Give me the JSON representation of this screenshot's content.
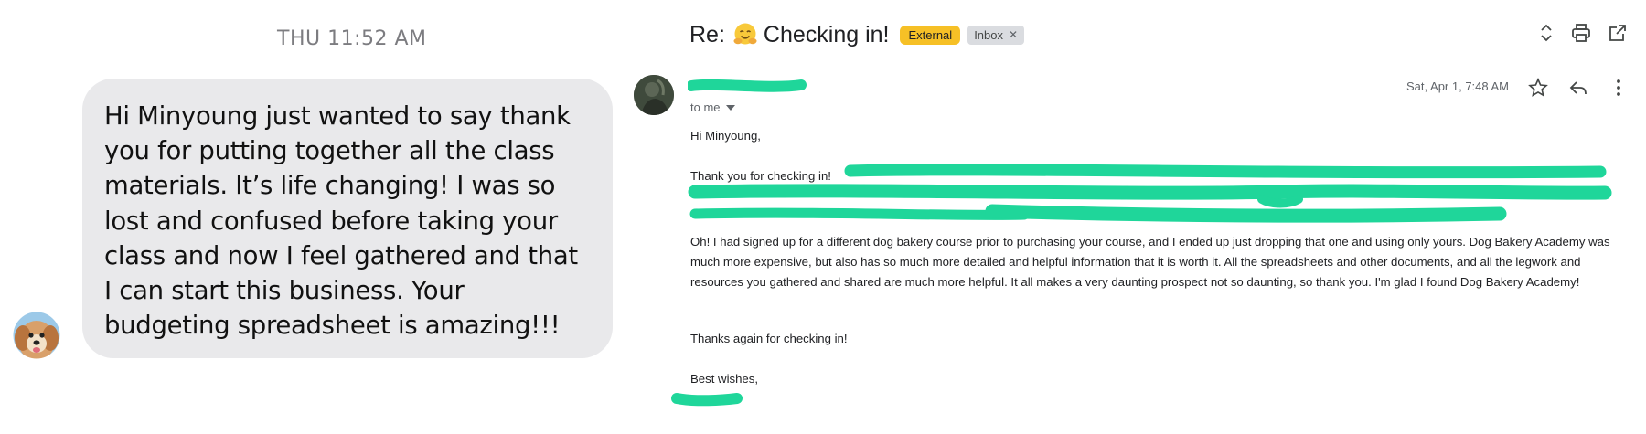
{
  "message": {
    "timestamp": "THU 11:52 AM",
    "bubble_text": "Hi Minyoung just wanted to say thank you for putting together all the class materials. It’s life changing! I was so lost and confused before taking your class and now I feel gathered and that I can start this business. Your budgeting spreadsheet is amazing!!!"
  },
  "email": {
    "subject_prefix": "Re:",
    "subject_text": "Checking in!",
    "labels": {
      "external": "External",
      "inbox": "Inbox"
    },
    "recipient": "to me",
    "date": "Sat, Apr 1, 7:48 AM",
    "greeting": "Hi Minyoung,",
    "thanks_line": "Thank you for checking in!",
    "paragraph2": "Oh! I had signed up for a different dog bakery course prior to purchasing your course, and I ended up just dropping that one and using only yours. Dog Bakery Academy was much more expensive, but also has so much more detailed and helpful information that it is worth it. All the spreadsheets and other documents, and all the legwork and resources you gathered and shared are much more helpful. It all makes a very daunting prospect not so daunting, so thank you. I'm glad I found Dog Bakery Academy!",
    "thanks_again": "Thanks again for checking in!",
    "sign_off": "Best wishes,"
  },
  "colors": {
    "redaction": "#1fd69a",
    "external_badge": "#f6c026",
    "bubble": "#e9e9eb"
  },
  "icons": [
    "hug-emoji-icon",
    "expand-collapse-icon",
    "print-icon",
    "open-in-new-window-icon",
    "star-icon",
    "reply-icon",
    "more-vert-icon",
    "dropdown-caret-icon",
    "close-icon"
  ]
}
